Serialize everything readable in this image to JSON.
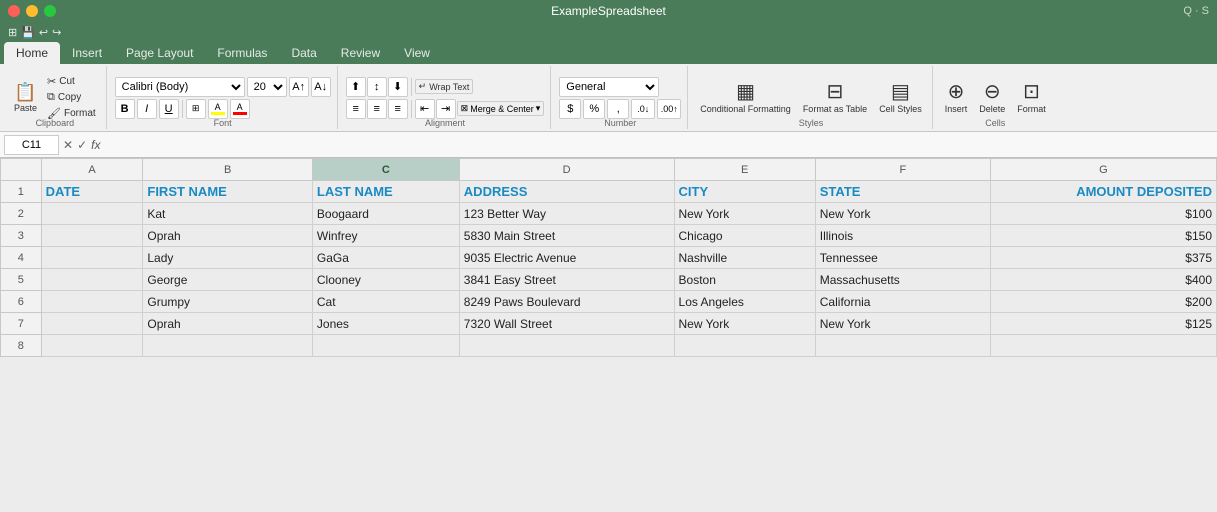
{
  "titleBar": {
    "title": "ExampleSpreadsheet",
    "closeBtn": "●",
    "minBtn": "●",
    "maxBtn": "●",
    "searchLabel": "Q · S"
  },
  "quickAccess": {
    "icons": [
      "⊞",
      "💾",
      "↩",
      "↪"
    ]
  },
  "ribbonTabs": {
    "tabs": [
      "Home",
      "Insert",
      "Page Layout",
      "Formulas",
      "Data",
      "Review",
      "View"
    ],
    "activeTab": "Home"
  },
  "ribbon": {
    "pasteLabel": "Paste",
    "cutLabel": "Cut",
    "copyLabel": "Copy",
    "formatLabel": "Format",
    "fontName": "Calibri (Body)",
    "fontSize": "20",
    "boldLabel": "B",
    "italicLabel": "I",
    "underlineLabel": "U",
    "wrapTextLabel": "Wrap Text",
    "mergeCenterLabel": "Merge & Center",
    "numberFormat": "General",
    "conditionalFormattingLabel": "Conditional Formatting",
    "formatAsTableLabel": "Format as Table",
    "cellStylesLabel": "Cell Styles",
    "insertLabel": "Insert",
    "deleteLabel": "Delete",
    "formatRibbonLabel": "Format",
    "groups": {
      "clipboard": "Clipboard",
      "font": "Font",
      "alignment": "Alignment",
      "number": "Number",
      "styles": "Styles",
      "cells": "Cells"
    }
  },
  "formulaBar": {
    "cellRef": "C11",
    "formula": ""
  },
  "columns": {
    "headers": [
      "A",
      "B",
      "C",
      "D",
      "E",
      "F",
      "G"
    ]
  },
  "spreadsheet": {
    "rows": [
      {
        "rowNum": "1",
        "cells": [
          "DATE",
          "FIRST NAME",
          "LAST NAME",
          "ADDRESS",
          "CITY",
          "STATE",
          "AMOUNT DEPOSITED"
        ],
        "isHeader": true
      },
      {
        "rowNum": "2",
        "cells": [
          "",
          "Kat",
          "Boogaard",
          "123 Better Way",
          "New York",
          "New York",
          "$100"
        ],
        "isHeader": false
      },
      {
        "rowNum": "3",
        "cells": [
          "",
          "Oprah",
          "Winfrey",
          "5830 Main Street",
          "Chicago",
          "Illinois",
          "$150"
        ],
        "isHeader": false
      },
      {
        "rowNum": "4",
        "cells": [
          "",
          "Lady",
          "GaGa",
          "9035 Electric Avenue",
          "Nashville",
          "Tennessee",
          "$375"
        ],
        "isHeader": false
      },
      {
        "rowNum": "5",
        "cells": [
          "",
          "George",
          "Clooney",
          "3841 Easy Street",
          "Boston",
          "Massachusetts",
          "$400"
        ],
        "isHeader": false
      },
      {
        "rowNum": "6",
        "cells": [
          "",
          "Grumpy",
          "Cat",
          "8249 Paws Boulevard",
          "Los Angeles",
          "California",
          "$200"
        ],
        "isHeader": false
      },
      {
        "rowNum": "7",
        "cells": [
          "",
          "Oprah",
          "Jones",
          "7320 Wall Street",
          "New York",
          "New York",
          "$125"
        ],
        "isHeader": false
      },
      {
        "rowNum": "8",
        "cells": [
          "",
          "",
          "",
          "",
          "",
          "",
          ""
        ],
        "isHeader": false
      }
    ]
  }
}
